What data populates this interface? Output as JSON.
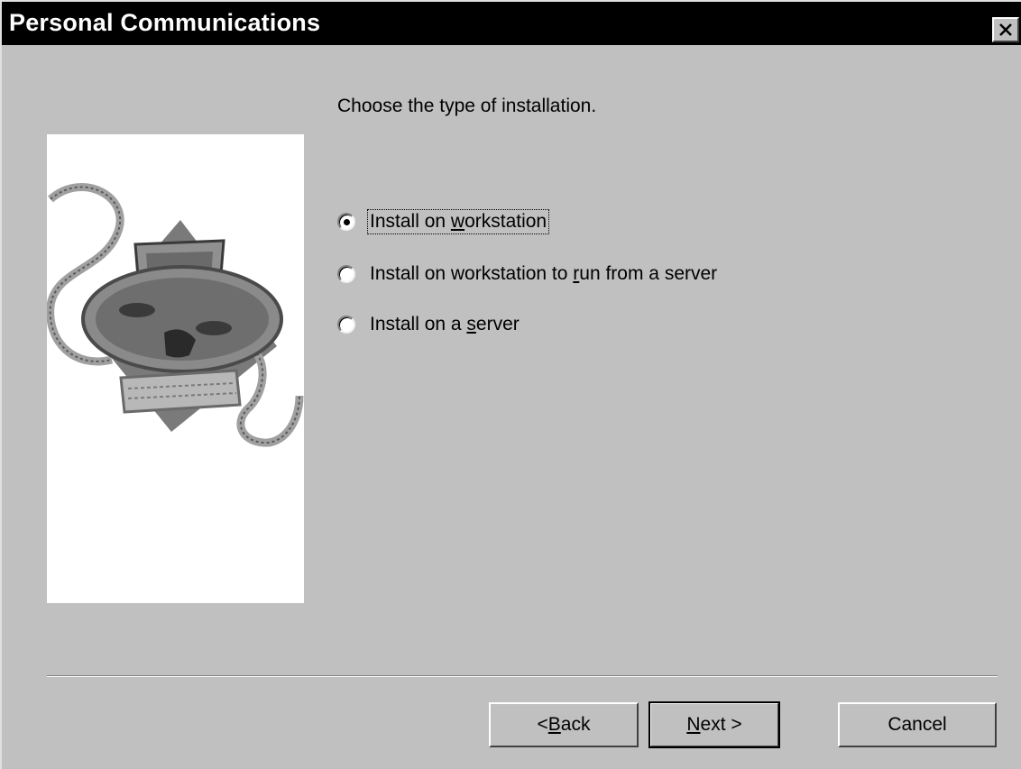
{
  "window": {
    "title": "Personal Communications"
  },
  "page": {
    "heading": "Choose the type of installation."
  },
  "options": [
    {
      "pre": "Install on ",
      "key": "w",
      "post": "orkstation",
      "checked": true,
      "focused": true
    },
    {
      "pre": "Install on workstation to ",
      "key": "r",
      "post": "un from a server",
      "checked": false,
      "focused": false
    },
    {
      "pre": "Install on a ",
      "key": "s",
      "post": "erver",
      "checked": false,
      "focused": false
    }
  ],
  "buttons": {
    "back": {
      "pre": "< ",
      "key": "B",
      "post": "ack"
    },
    "next": {
      "pre": "",
      "key": "N",
      "post": "ext >"
    },
    "cancel": "Cancel"
  },
  "colors": {
    "dialog_bg": "#c0c0c0",
    "titlebar_bg": "#000000",
    "panel_bg": "#ffffff"
  },
  "icons": {
    "close": "close-icon",
    "illustration": "installer-computer-illustration"
  }
}
